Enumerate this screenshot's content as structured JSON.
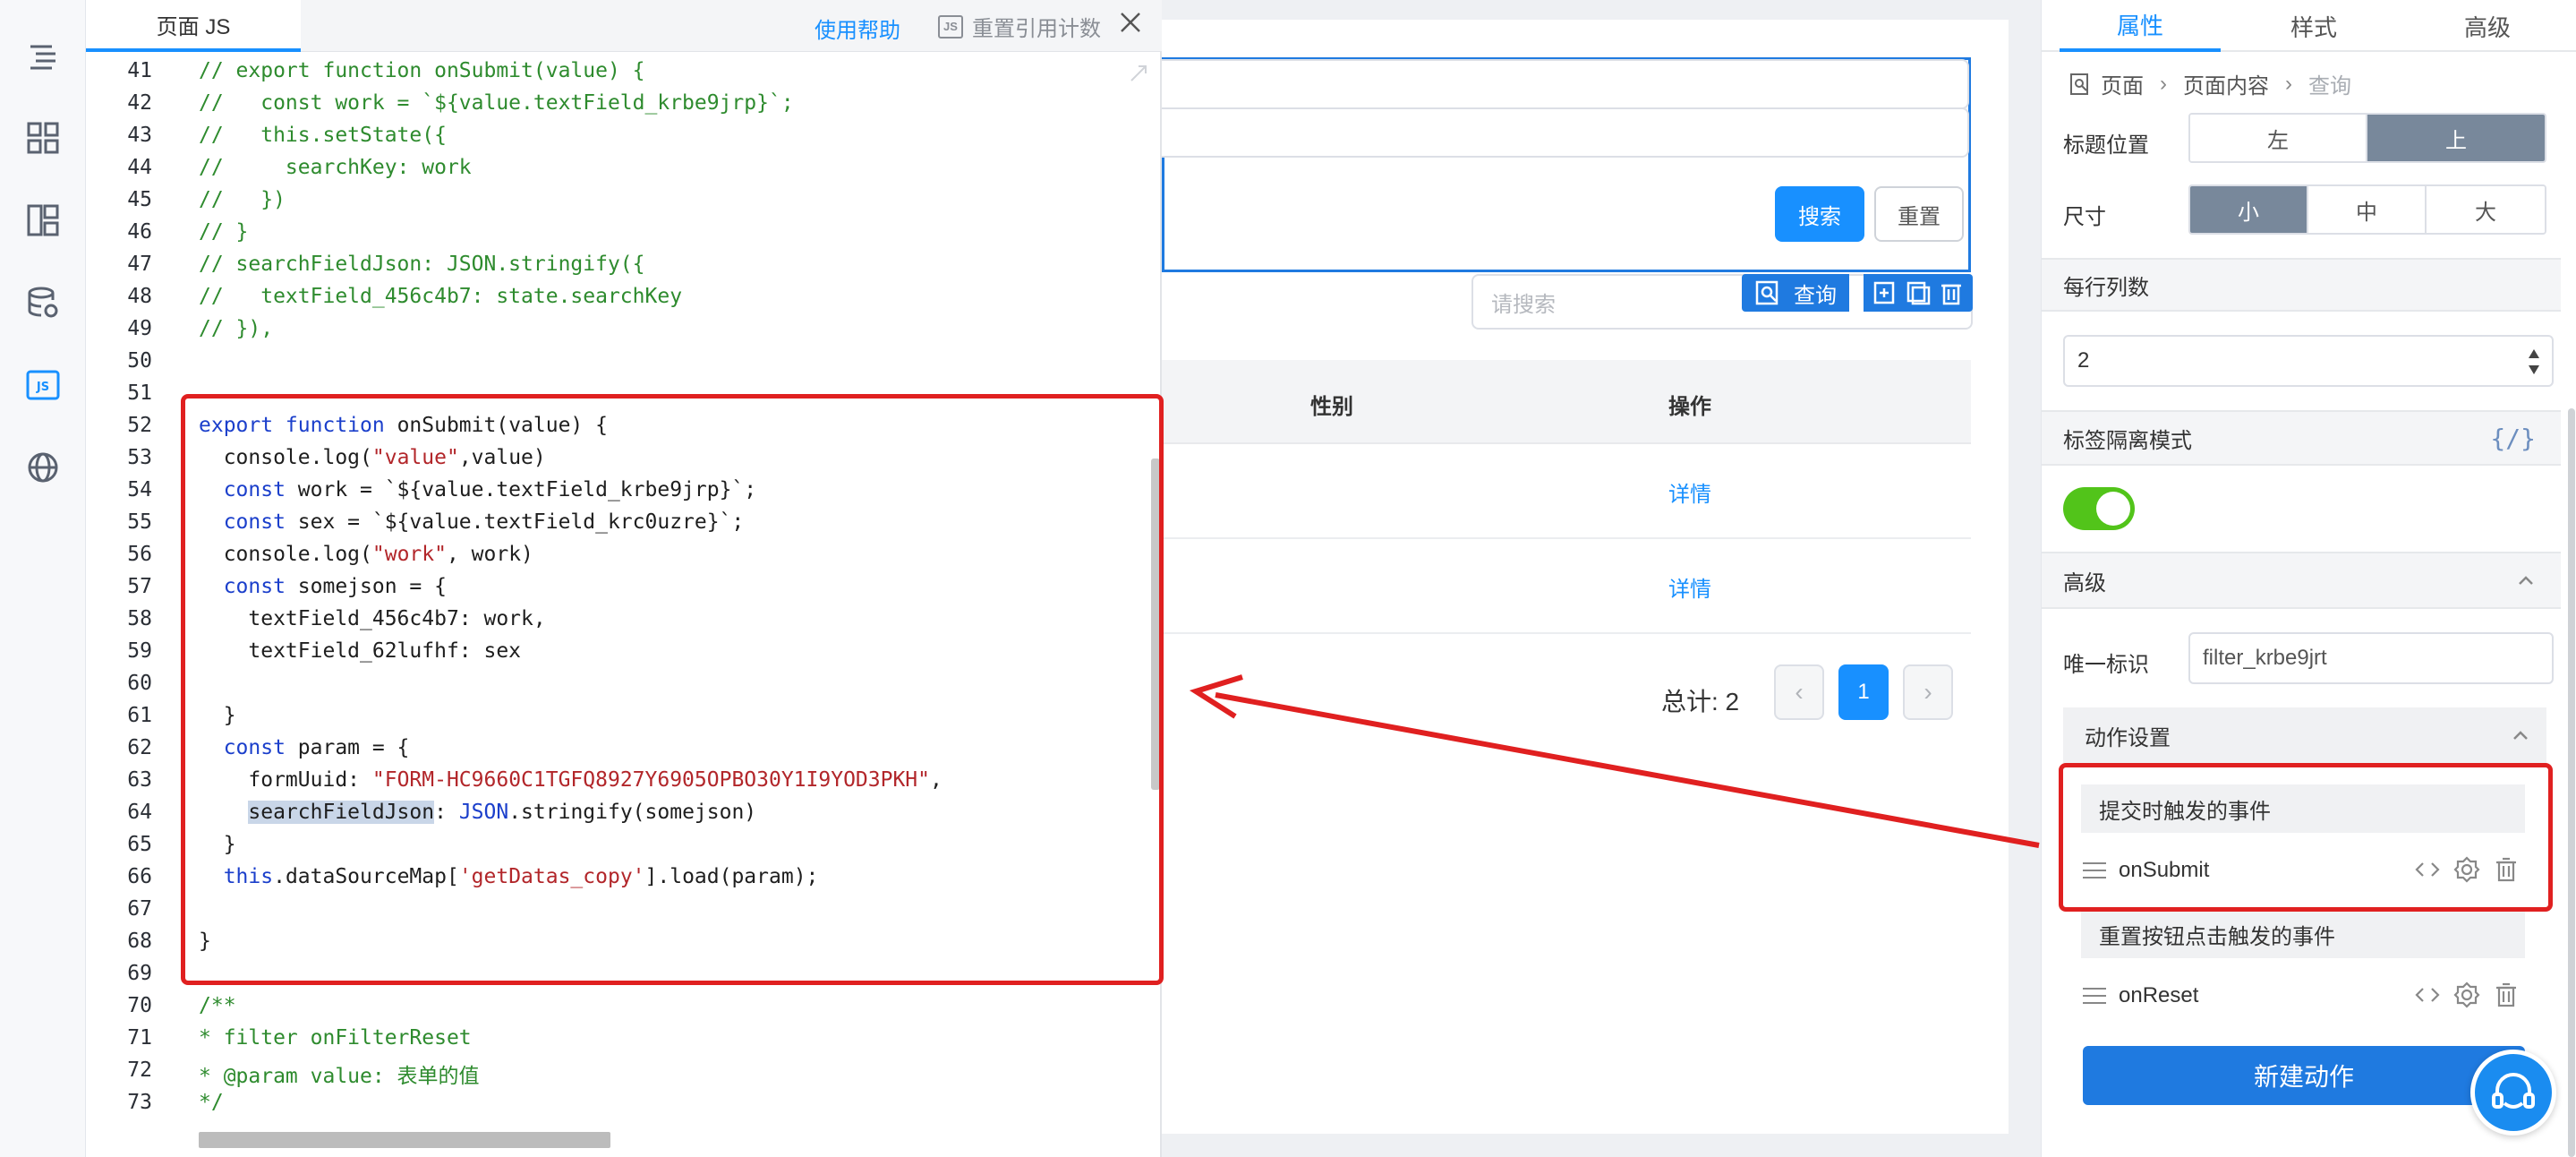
{
  "rail": {
    "icons": [
      "outline-icon",
      "components-icon",
      "layout-icon",
      "datasource-icon",
      "js-icon",
      "globe-icon"
    ],
    "js_badge": "JS"
  },
  "editor": {
    "tab": "页面 JS",
    "help": "使用帮助",
    "reset_badge": "JS",
    "reset_ref": "重置引用计数",
    "line_numbers": [
      "41",
      "42",
      "43",
      "44",
      "45",
      "46",
      "47",
      "48",
      "49",
      "50",
      "51",
      "52",
      "53",
      "54",
      "55",
      "56",
      "57",
      "58",
      "59",
      "60",
      "61",
      "62",
      "63",
      "64",
      "65",
      "66",
      "67",
      "68",
      "69",
      "70",
      "71",
      "72",
      "73"
    ],
    "code": {
      "l41": "// export function onSubmit(value) {",
      "l42": "//   const work = `${value.textField_krbe9jrp}`;",
      "l43": "//   this.setState({",
      "l44": "//     searchKey: work",
      "l45": "//   })",
      "l46": "// }",
      "l47": "// searchFieldJson: JSON.stringify({",
      "l48": "//   textField_456c4b7: state.searchKey",
      "l49": "// }),",
      "l52a": "export function",
      "l52b": " onSubmit(value) {",
      "l53a": "  console.log(",
      "l53b": "\"value\"",
      "l53c": ",value)",
      "l54a": "  const",
      "l54b": " work = `${value.textField_krbe9jrp}`;",
      "l55a": "  const",
      "l55b": " sex = `${value.textField_krc0uzre}`;",
      "l56a": "  console.log(",
      "l56b": "\"work\"",
      "l56c": ", work)",
      "l57a": "  const",
      "l57b": " somejson = {",
      "l58": "    textField_456c4b7: work,",
      "l59": "    textField_62lufhf: sex",
      "l61": "  }",
      "l62a": "  const",
      "l62b": " param = {",
      "l63a": "    formUuid: ",
      "l63b": "\"FORM-HC9660C1TGFQ8927Y6905OPBO30Y1I9YOD3PKH\"",
      "l63c": ",",
      "l64a": "searchFieldJson",
      "l64b": ": ",
      "l64c": "JSON",
      "l64d": ".stringify(somejson)",
      "l65": "  }",
      "l66a": "  this",
      "l66b": ".dataSourceMap[",
      "l66c": "'getDatas_copy'",
      "l66d": "].load(param);",
      "l68": "}",
      "l70": "/**",
      "l71": "* filter onFilterReset",
      "l72": "* @param value: 表单的值",
      "l73": "*/"
    }
  },
  "preview": {
    "search_btn": "搜索",
    "reset_btn": "重置",
    "search_placeholder": "请搜索",
    "selected_tag": "查询",
    "col_gender": "性别",
    "col_action": "操作",
    "rows": [
      {
        "action": "详情"
      },
      {
        "action": "详情"
      }
    ],
    "total": "总计: 2",
    "page_prev": "‹",
    "page_current": "1",
    "page_next": "›"
  },
  "panel": {
    "tabs": [
      "属性",
      "样式",
      "高级"
    ],
    "breadcrumb": [
      "页面",
      "页面内容",
      "查询"
    ],
    "label_position": "标题位置",
    "label_position_options": [
      "左",
      "上"
    ],
    "size": "尺寸",
    "size_options": [
      "小",
      "中",
      "大"
    ],
    "per_row": "每行列数",
    "per_row_value": "2",
    "tag_mode": "标签隔离模式",
    "bind_symbol": "{/}",
    "advanced": "高级",
    "unique_id_label": "唯一标识",
    "unique_id_value": "filter_krbe9jrt",
    "action_settings": "动作设置",
    "submit_event": "提交时触发的事件",
    "submit_handler": "onSubmit",
    "reset_event": "重置按钮点击触发的事件",
    "reset_handler": "onReset",
    "new_action": "新建动作"
  },
  "colors": {
    "accent": "#1890ff",
    "annotation": "#e02020",
    "switch_on": "#52c41a",
    "segment_on": "#78889b"
  }
}
